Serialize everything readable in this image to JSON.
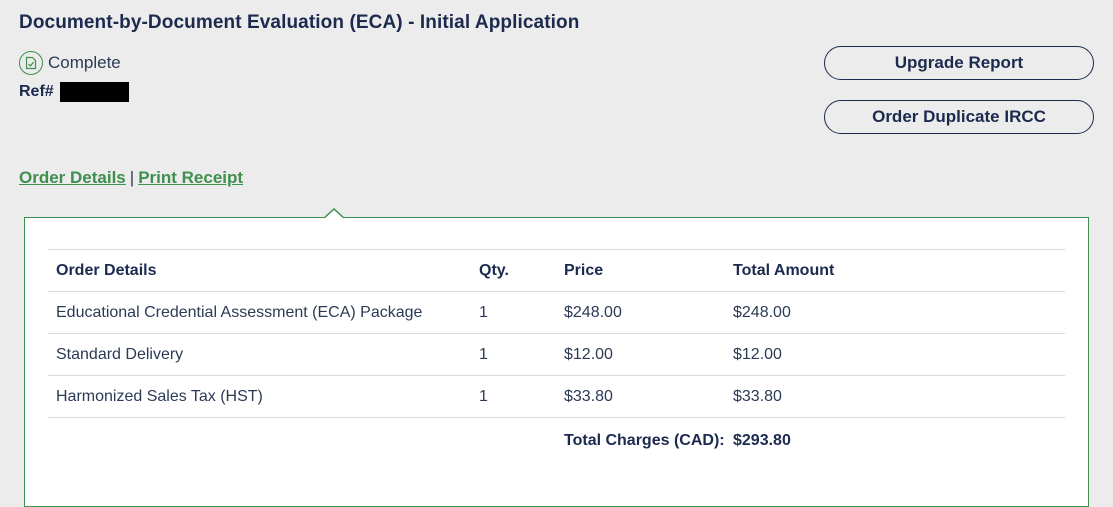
{
  "header": {
    "title": "Document-by-Document Evaluation (ECA) - Initial Application",
    "status": "Complete",
    "status_icon": "document-check-icon",
    "ref_label": "Ref#"
  },
  "actions": {
    "upgrade_label": "Upgrade Report",
    "duplicate_label": "Order Duplicate IRCC"
  },
  "links": {
    "order_details": "Order Details",
    "separator": "|",
    "print_receipt": "Print Receipt"
  },
  "colors": {
    "accent_green": "#3f8f4e",
    "navy": "#1b2a4e",
    "background": "#ececec"
  },
  "table": {
    "headers": [
      "Order Details",
      "Qty.",
      "Price",
      "Total Amount"
    ],
    "rows": [
      {
        "desc": "Educational Credential Assessment (ECA) Package",
        "qty": "1",
        "price": "$248.00",
        "total": "$248.00"
      },
      {
        "desc": "Standard Delivery",
        "qty": "1",
        "price": "$12.00",
        "total": "$12.00"
      },
      {
        "desc": "Harmonized Sales Tax (HST)",
        "qty": "1",
        "price": "$33.80",
        "total": "$33.80"
      }
    ],
    "total_label": "Total Charges (CAD):",
    "total_value": "$293.80"
  }
}
